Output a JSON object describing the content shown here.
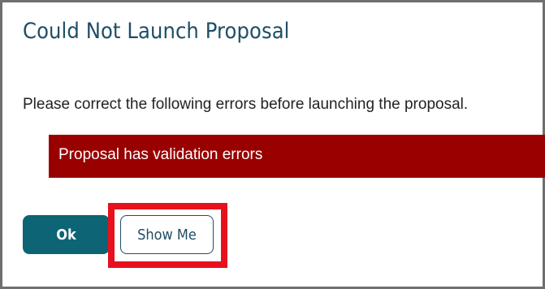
{
  "dialog": {
    "title": "Could Not Launch Proposal",
    "message": "Please correct the following errors before launching the proposal.",
    "error": "Proposal has validation errors",
    "ok_label": "Ok",
    "show_me_label": "Show Me"
  },
  "colors": {
    "title_text": "#1f4e66",
    "error_background": "#990000",
    "primary_button": "#0c6474",
    "highlight": "#e8101d",
    "frame_border": "#6f6f6f"
  }
}
